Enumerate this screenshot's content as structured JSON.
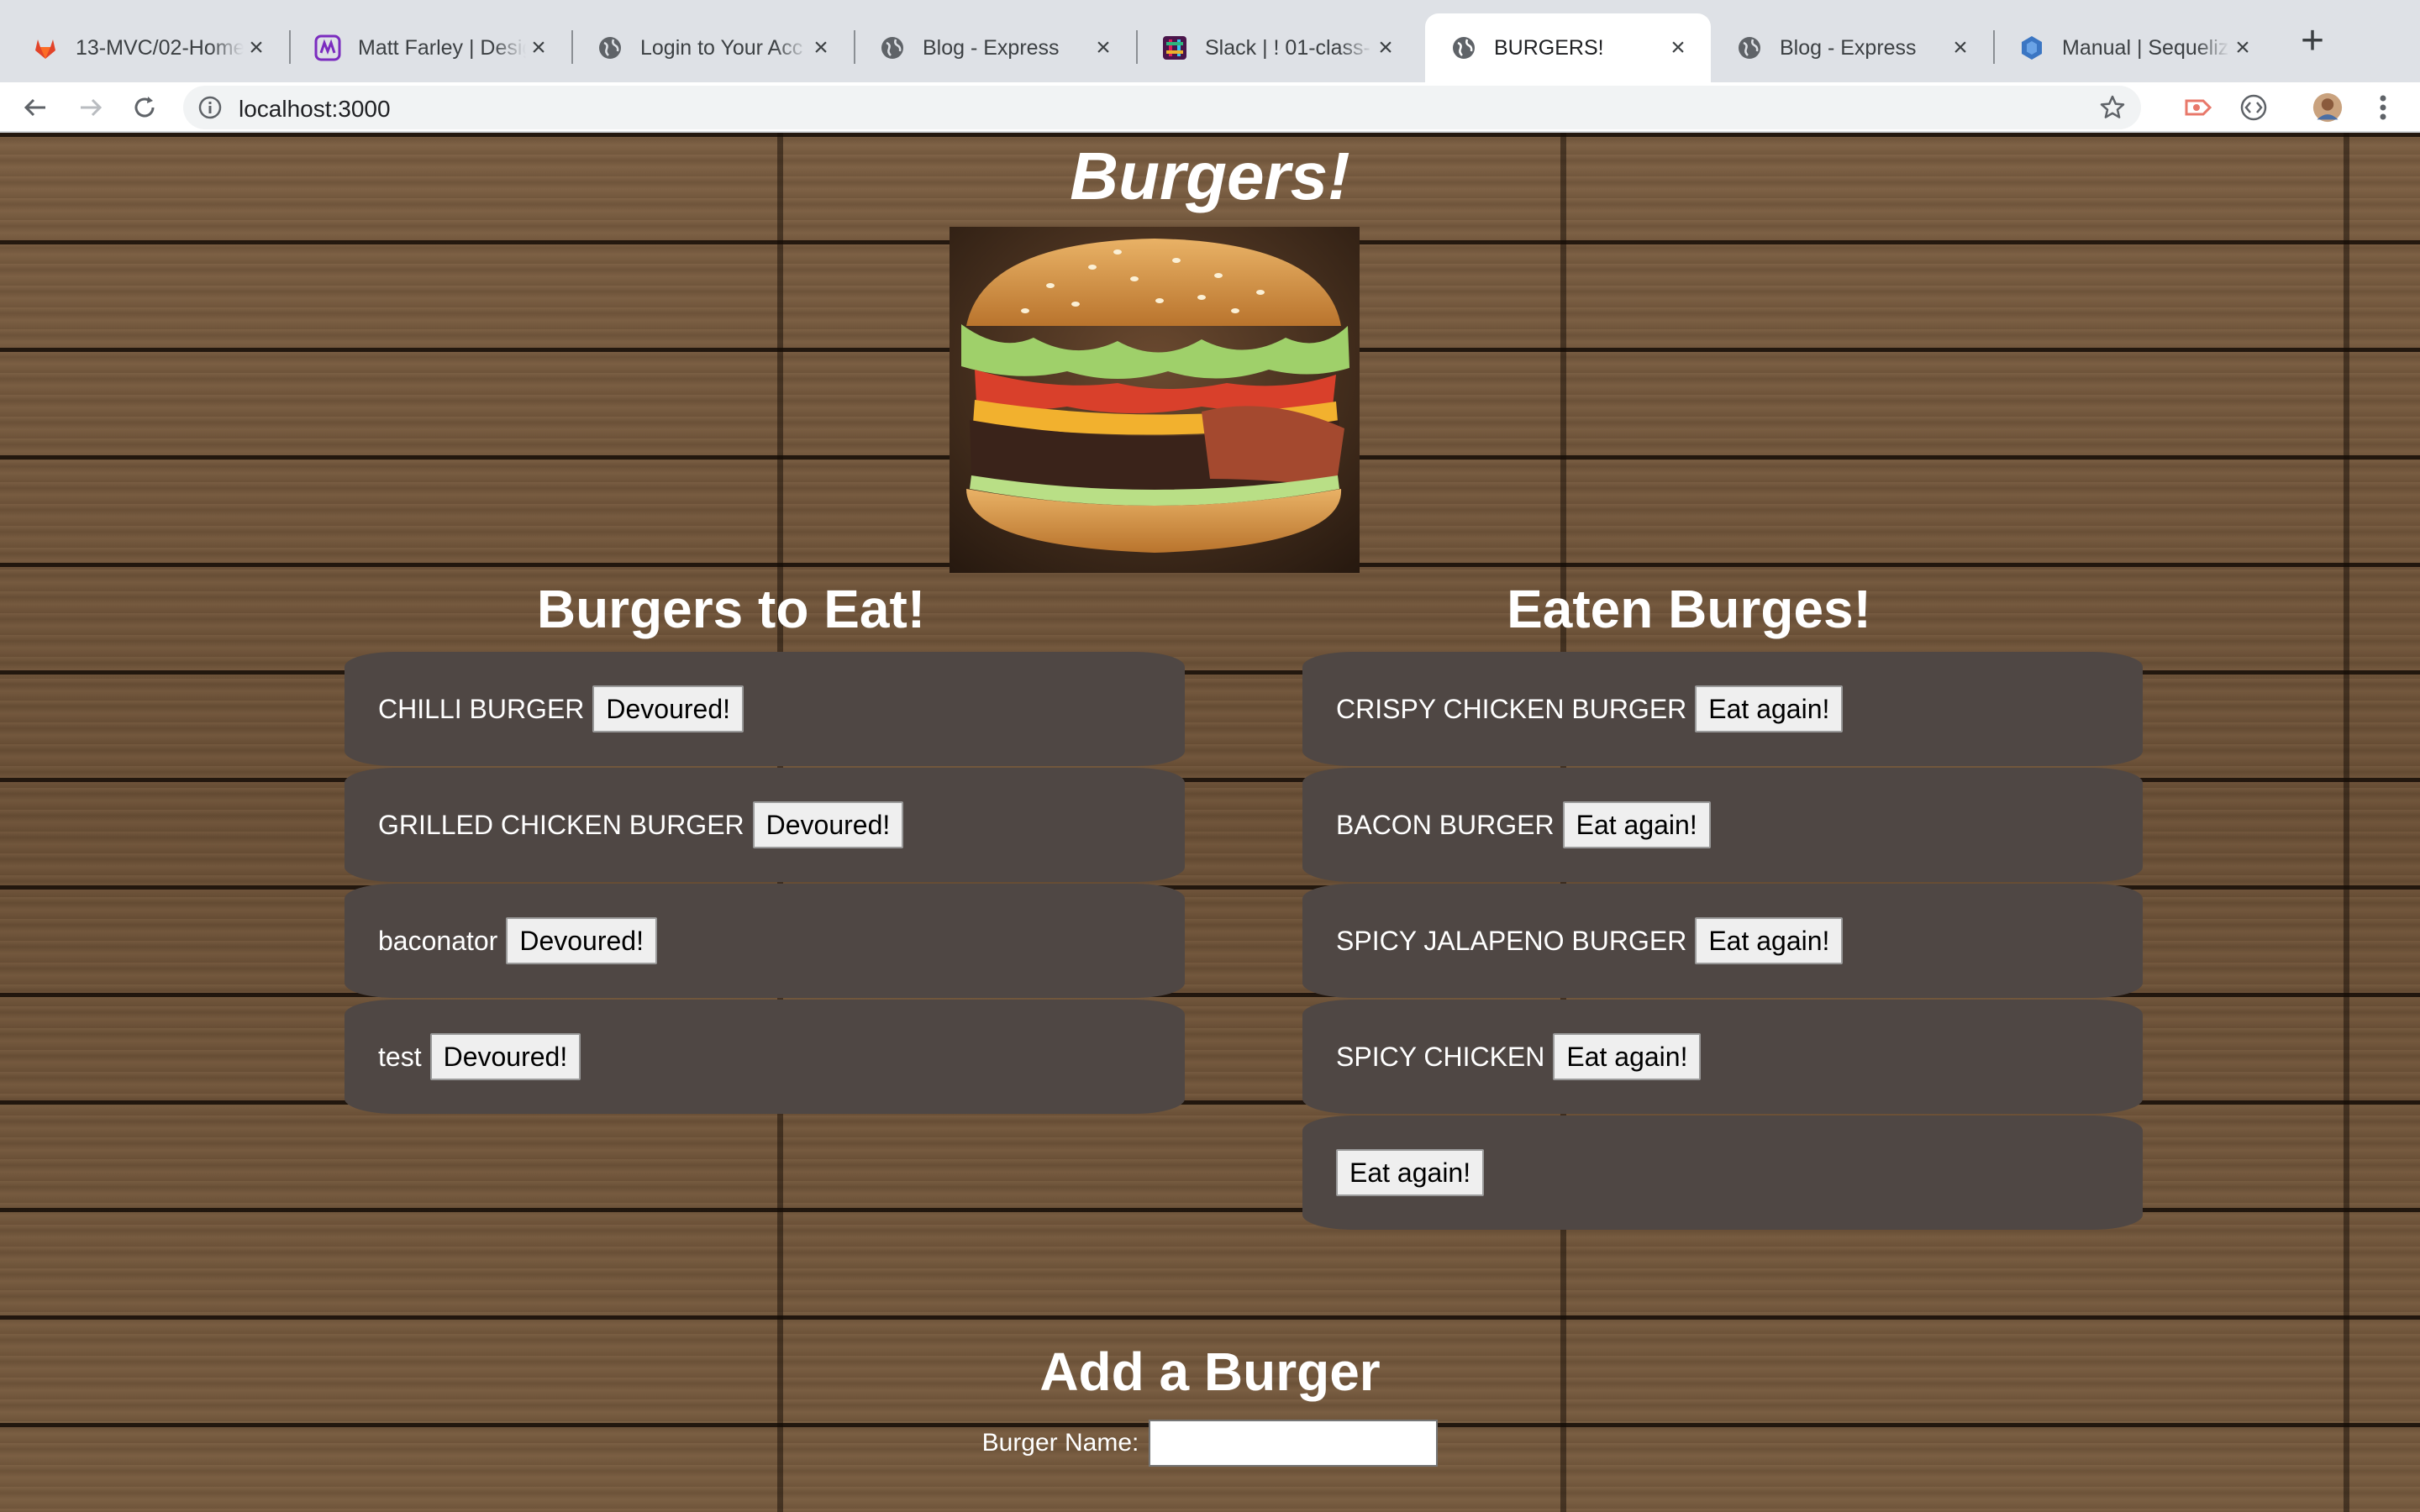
{
  "browser": {
    "tabs": [
      {
        "title": "13-MVC/02-Home",
        "icon": "gitlab-icon",
        "active": false
      },
      {
        "title": "Matt Farley | Desig",
        "icon": "portfolio-icon",
        "active": false
      },
      {
        "title": "Login to Your Acc",
        "icon": "globe-icon",
        "active": false
      },
      {
        "title": "Blog - Express",
        "icon": "globe-icon",
        "active": false
      },
      {
        "title": "Slack | ! 01-class-",
        "icon": "slack-icon",
        "active": false
      },
      {
        "title": "BURGERS!",
        "icon": "globe-icon",
        "active": true
      },
      {
        "title": "Blog - Express",
        "icon": "globe-icon",
        "active": false
      },
      {
        "title": "Manual | Sequelize",
        "icon": "sequelize-icon",
        "active": false
      }
    ],
    "close_glyph": "×",
    "new_tab_glyph": "+",
    "url": "localhost:3000"
  },
  "page": {
    "title": "Burgers!",
    "to_eat_heading": "Burgers to Eat!",
    "eaten_heading": "Eaten Burges!",
    "to_eat": [
      {
        "name": "CHILLI BURGER",
        "button": "Devoured!"
      },
      {
        "name": "GRILLED CHICKEN BURGER",
        "button": "Devoured!"
      },
      {
        "name": "baconator",
        "button": "Devoured!"
      },
      {
        "name": "test",
        "button": "Devoured!"
      }
    ],
    "eaten": [
      {
        "name": "CRISPY CHICKEN BURGER",
        "button": "Eat again!"
      },
      {
        "name": "BACON BURGER",
        "button": "Eat again!"
      },
      {
        "name": "SPICY JALAPENO BURGER",
        "button": "Eat again!"
      },
      {
        "name": "SPICY CHICKEN",
        "button": "Eat again!"
      },
      {
        "name": "",
        "button": "Eat again!"
      }
    ],
    "add_heading": "Add a Burger",
    "form_label": "Burger Name:",
    "form_value": ""
  },
  "colors": {
    "item_bg": "#4f4744",
    "wood": "#6b5138",
    "tab_strip": "#dee1e6"
  }
}
